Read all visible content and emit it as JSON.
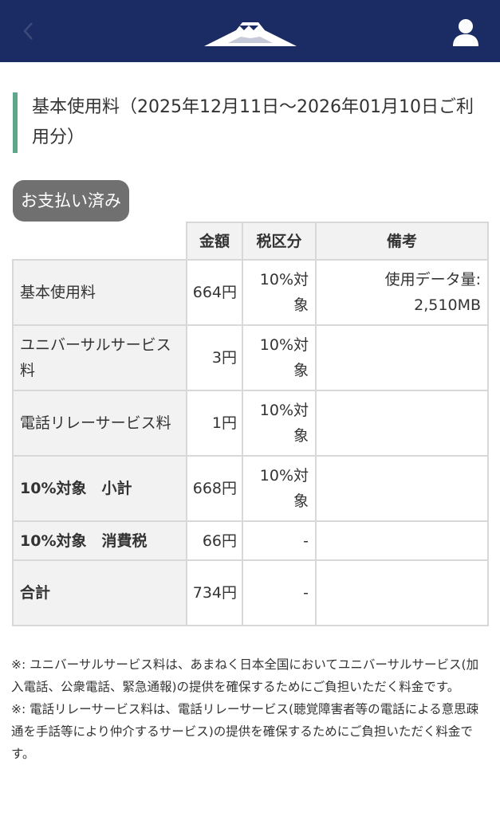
{
  "header": {
    "back_icon": "chevron-left-icon",
    "logo_icon": "mount-fuji-logo",
    "user_icon": "user-icon",
    "background": "#1b2b63"
  },
  "section": {
    "title": "基本使用料（2025年12月11日〜2026年01月10日ご利用分）",
    "accent_color": "#5fa68a",
    "status_badge": "お支払い済み"
  },
  "table": {
    "headers": [
      "金額",
      "税区分",
      "備考"
    ],
    "rows": [
      {
        "item": "基本使用料",
        "amount": "664円",
        "tax": "10%対象",
        "note": "使用データ量: 2,510MB",
        "bold": false
      },
      {
        "item": "ユニバーサルサービス料",
        "amount": "3円",
        "tax": "10%対象",
        "note": "",
        "bold": false
      },
      {
        "item": "電話リレーサービス料",
        "amount": "1円",
        "tax": "10%対象",
        "note": "",
        "bold": false
      },
      {
        "item": "10%対象　小計",
        "amount": "668円",
        "tax": "10%対象",
        "note": "",
        "bold": true
      },
      {
        "item": "10%対象　消費税",
        "amount": "66円",
        "tax": "-",
        "note": "",
        "bold": true
      },
      {
        "item": "合計",
        "amount": "734円",
        "tax": "-",
        "note": "",
        "bold": true
      }
    ]
  },
  "notes": [
    "※: ユニバーサルサービス料は、あまねく日本全国においてユニバーサルサービス(加入電話、公衆電話、緊急通報)の提供を確保するためにご負担いただく料金です。",
    "※: 電話リレーサービス料は、電話リレーサービス(聴覚障害者等の電話による意思疎通を手話等により仲介するサービス)の提供を確保するためにご負担いただく料金です。"
  ]
}
